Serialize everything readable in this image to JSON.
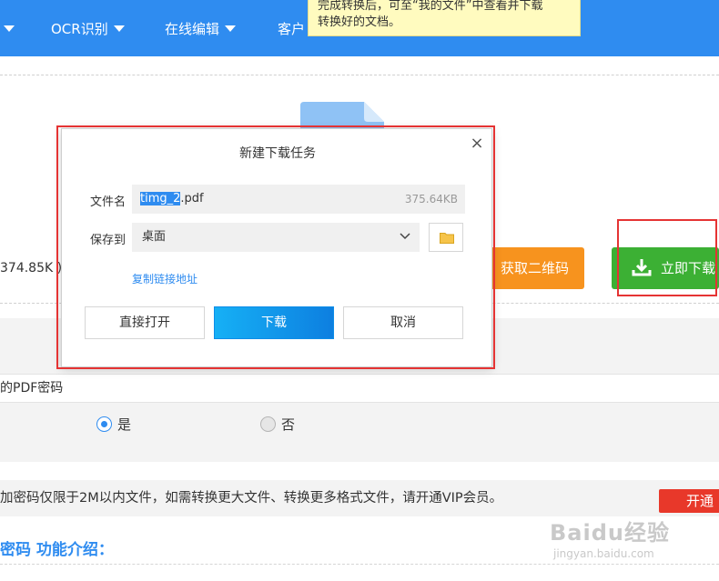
{
  "nav": {
    "items": [
      {
        "label": ""
      },
      {
        "label": "OCR识别"
      },
      {
        "label": "在线编辑"
      },
      {
        "label": "客户"
      }
    ]
  },
  "tooltip": {
    "line1": "完成转换后，可至“我的文件”中查看并下载",
    "line2": "转换好的文档。"
  },
  "upload": {
    "file_size": "374.85K )"
  },
  "buttons": {
    "qr_code": "获取二维码",
    "download_now": "立即下载",
    "vip": "开通"
  },
  "settings": {
    "pwd_label": "的PDF密码",
    "option_yes": "是",
    "option_no": "否",
    "selected": "是"
  },
  "notice": {
    "text": "加密码仅限于2M以内文件，如需转换更大文件、转换更多格式文件，请开通VIP会员。"
  },
  "section": {
    "title": "密码 功能介绍："
  },
  "watermark": {
    "main": "Baidu经验",
    "sub": "jingyan.baidu.com"
  },
  "dialog": {
    "title": "新建下载任务",
    "close": "×",
    "filename_label": "文件名",
    "filename_selected": "timg_2",
    "filename_ext": ".pdf",
    "filename_size": "375.64KB",
    "saveto_label": "保存到",
    "saveto_value": "桌面",
    "copy_link": "复制链接地址",
    "btn_open": "直接打开",
    "btn_download": "下载",
    "btn_cancel": "取消"
  },
  "colors": {
    "nav_blue": "#2f8cf0",
    "download_green": "#3cb034",
    "qr_orange": "#f7931e",
    "highlight_red": "#e53333"
  }
}
